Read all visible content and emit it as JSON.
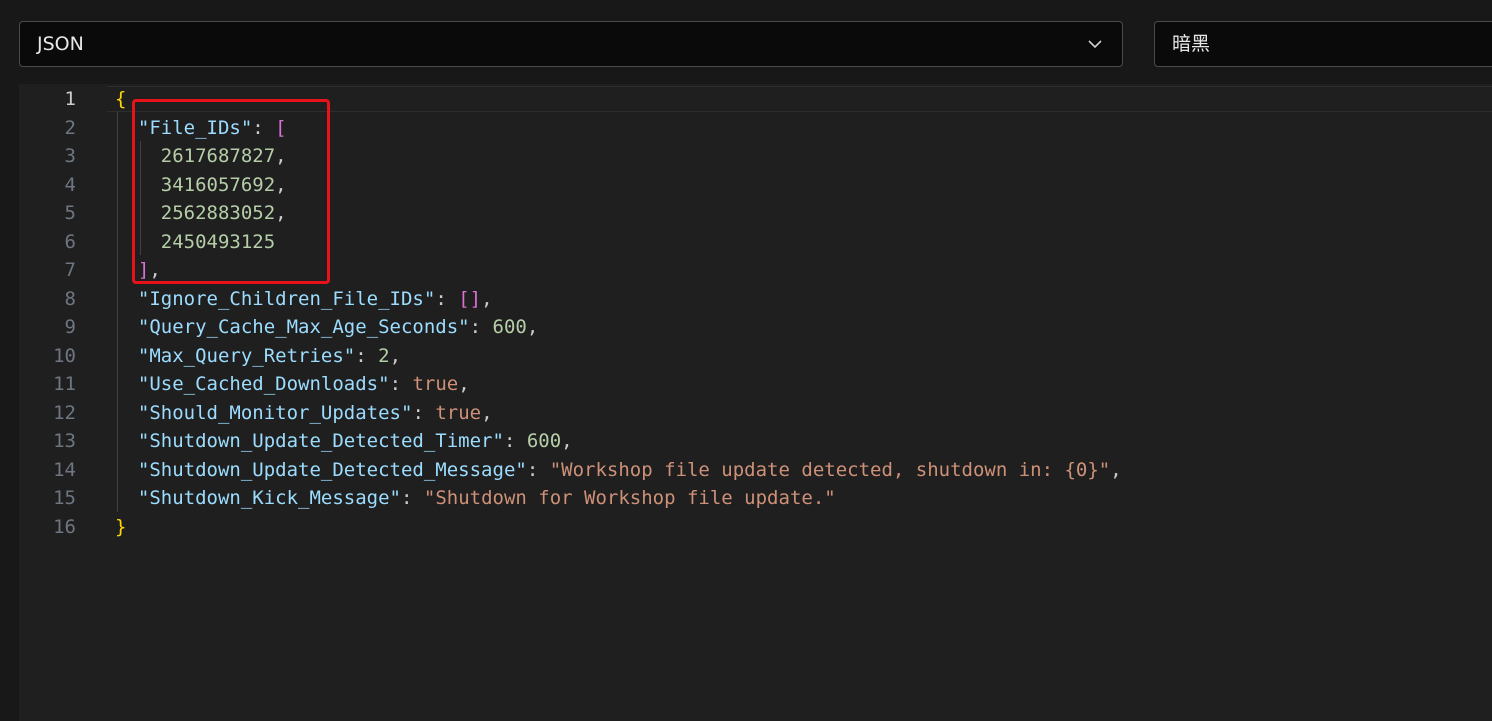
{
  "toolbar": {
    "language_value": "JSON",
    "theme_value": "暗黑"
  },
  "colors": {
    "key": "#9cdcfe",
    "string": "#ce9178",
    "number": "#b5cea8",
    "bracket_level1": "#ffd700",
    "bracket_level2": "#da70d6",
    "highlight_box": "#e8131a"
  },
  "editor": {
    "line_numbers": [
      "1",
      "2",
      "3",
      "4",
      "5",
      "6",
      "7",
      "8",
      "9",
      "10",
      "11",
      "12",
      "13",
      "14",
      "15",
      "16"
    ],
    "lines": [
      {
        "t": [
          [
            "br1",
            "{"
          ]
        ]
      },
      {
        "t": [
          [
            "pun",
            "  "
          ],
          [
            "key",
            "\"File_IDs\""
          ],
          [
            "pun",
            ": "
          ],
          [
            "br2",
            "["
          ]
        ]
      },
      {
        "t": [
          [
            "pun",
            "    "
          ],
          [
            "num",
            "2617687827"
          ],
          [
            "pun",
            ","
          ]
        ]
      },
      {
        "t": [
          [
            "pun",
            "    "
          ],
          [
            "num",
            "3416057692"
          ],
          [
            "pun",
            ","
          ]
        ]
      },
      {
        "t": [
          [
            "pun",
            "    "
          ],
          [
            "num",
            "2562883052"
          ],
          [
            "pun",
            ","
          ]
        ]
      },
      {
        "t": [
          [
            "pun",
            "    "
          ],
          [
            "num",
            "2450493125"
          ]
        ]
      },
      {
        "t": [
          [
            "pun",
            "  "
          ],
          [
            "br2",
            "]"
          ],
          [
            "pun",
            ","
          ]
        ]
      },
      {
        "t": [
          [
            "pun",
            "  "
          ],
          [
            "key",
            "\"Ignore_Children_File_IDs\""
          ],
          [
            "pun",
            ": "
          ],
          [
            "br2",
            "[]"
          ],
          [
            "pun",
            ","
          ]
        ]
      },
      {
        "t": [
          [
            "pun",
            "  "
          ],
          [
            "key",
            "\"Query_Cache_Max_Age_Seconds\""
          ],
          [
            "pun",
            ": "
          ],
          [
            "num",
            "600"
          ],
          [
            "pun",
            ","
          ]
        ]
      },
      {
        "t": [
          [
            "pun",
            "  "
          ],
          [
            "key",
            "\"Max_Query_Retries\""
          ],
          [
            "pun",
            ": "
          ],
          [
            "num",
            "2"
          ],
          [
            "pun",
            ","
          ]
        ]
      },
      {
        "t": [
          [
            "pun",
            "  "
          ],
          [
            "key",
            "\"Use_Cached_Downloads\""
          ],
          [
            "pun",
            ": "
          ],
          [
            "kw",
            "true"
          ],
          [
            "pun",
            ","
          ]
        ]
      },
      {
        "t": [
          [
            "pun",
            "  "
          ],
          [
            "key",
            "\"Should_Monitor_Updates\""
          ],
          [
            "pun",
            ": "
          ],
          [
            "kw",
            "true"
          ],
          [
            "pun",
            ","
          ]
        ]
      },
      {
        "t": [
          [
            "pun",
            "  "
          ],
          [
            "key",
            "\"Shutdown_Update_Detected_Timer\""
          ],
          [
            "pun",
            ": "
          ],
          [
            "num",
            "600"
          ],
          [
            "pun",
            ","
          ]
        ]
      },
      {
        "t": [
          [
            "pun",
            "  "
          ],
          [
            "key",
            "\"Shutdown_Update_Detected_Message\""
          ],
          [
            "pun",
            ": "
          ],
          [
            "str",
            "\"Workshop file update detected, shutdown in: {0}\""
          ],
          [
            "pun",
            ","
          ]
        ]
      },
      {
        "t": [
          [
            "pun",
            "  "
          ],
          [
            "key",
            "\"Shutdown_Kick_Message\""
          ],
          [
            "pun",
            ": "
          ],
          [
            "str",
            "\"Shutdown for Workshop file update.\""
          ]
        ]
      },
      {
        "t": [
          [
            "br1",
            "}"
          ]
        ]
      }
    ]
  }
}
